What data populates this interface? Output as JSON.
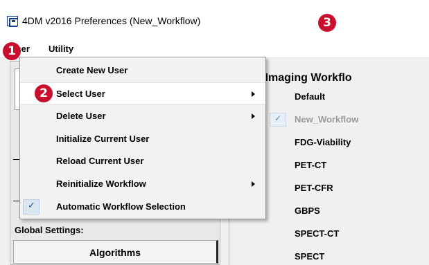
{
  "window": {
    "title": "4DM v2016 Preferences (New_Workflow)",
    "icon": "app-logo-icon"
  },
  "callouts": [
    "1",
    "2",
    "3"
  ],
  "menubar": {
    "items": [
      "User",
      "Utility"
    ]
  },
  "user_menu": {
    "items": [
      {
        "label": "Create New User",
        "submenu": false,
        "checked": false,
        "highlighted": false
      },
      {
        "label": "Select User",
        "submenu": true,
        "checked": false,
        "highlighted": true
      },
      {
        "label": "Delete User",
        "submenu": true,
        "checked": false,
        "highlighted": false
      },
      {
        "label": "Initialize Current User",
        "submenu": false,
        "checked": false,
        "highlighted": false
      },
      {
        "label": "Reload Current User",
        "submenu": false,
        "checked": false,
        "highlighted": false
      },
      {
        "label": "Reinitialize Workflow",
        "submenu": true,
        "checked": false,
        "highlighted": false
      },
      {
        "label": "Automatic Workflow Selection",
        "submenu": false,
        "checked": true,
        "highlighted": false
      }
    ]
  },
  "left_panel": {
    "global_settings_label": "Global Settings:",
    "algorithms_button": "Algorithms"
  },
  "workflow_panel": {
    "title": "ecular Imaging Workflo",
    "items": [
      {
        "label": "Default",
        "selected": false
      },
      {
        "label": "New_Workflow",
        "selected": true
      },
      {
        "label": "FDG-Viability",
        "selected": false
      },
      {
        "label": "PET-CT",
        "selected": false
      },
      {
        "label": "PET-CFR",
        "selected": false
      },
      {
        "label": "GBPS",
        "selected": false
      },
      {
        "label": "SPECT-CT",
        "selected": false
      },
      {
        "label": "SPECT",
        "selected": false
      }
    ]
  },
  "colors": {
    "callout": "#c8102e",
    "menu_bg": "#f2f2f2",
    "check_accent": "#1f4f86"
  }
}
